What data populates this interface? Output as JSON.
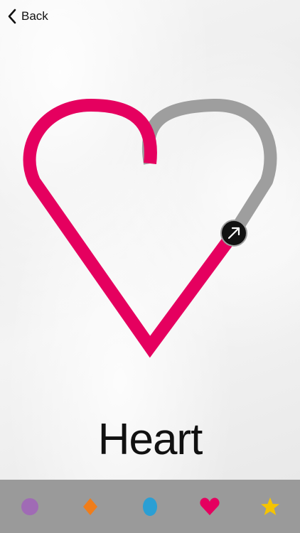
{
  "nav": {
    "back_label": "Back"
  },
  "shape": {
    "title": "Heart",
    "progress": 0.62,
    "colors": {
      "drawn": "#e5005f",
      "remaining": "#9e9e9e",
      "cursor": "#111111"
    }
  },
  "tabs": [
    {
      "name": "circle",
      "color": "#a06bb5"
    },
    {
      "name": "diamond",
      "color": "#f07d1a"
    },
    {
      "name": "oval",
      "color": "#2b9fd4"
    },
    {
      "name": "heart",
      "color": "#e5005f",
      "selected": true
    },
    {
      "name": "star",
      "color": "#f5c400"
    }
  ]
}
